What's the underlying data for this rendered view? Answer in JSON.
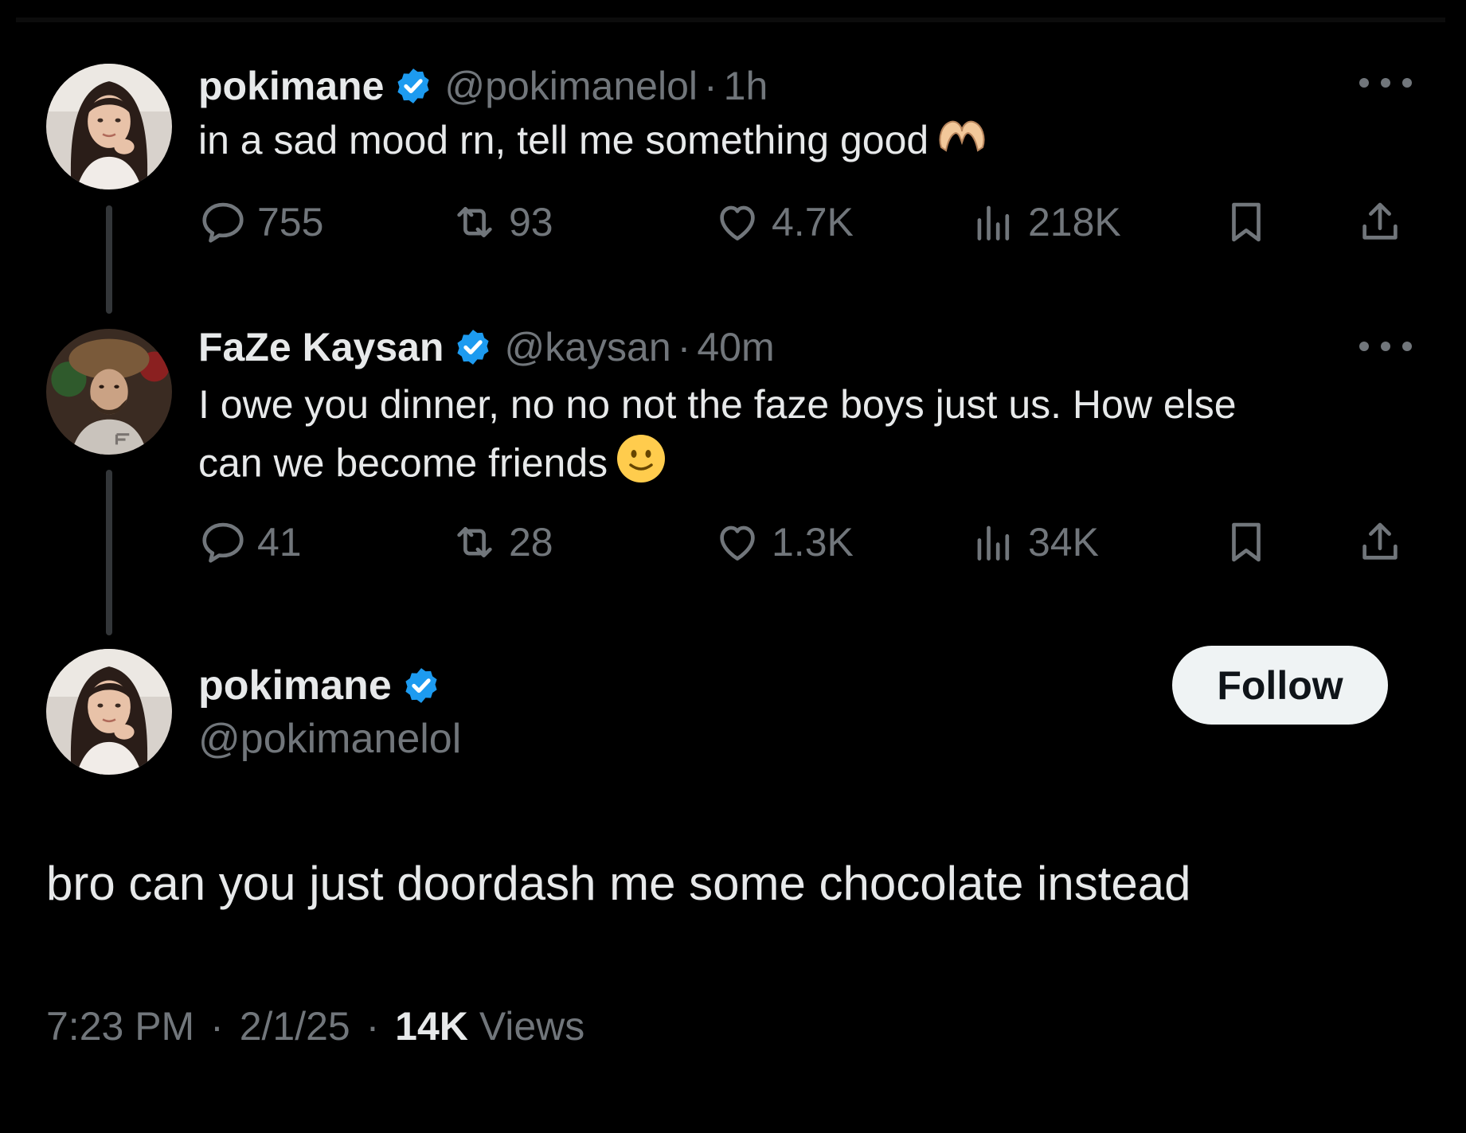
{
  "colors": {
    "background": "#000000",
    "primary_text": "#e7e9ea",
    "secondary_text": "#71767b",
    "verified_badge": "#1d9bf0",
    "follow_button_bg": "#eff3f4",
    "follow_button_text": "#0f1419"
  },
  "thread": [
    {
      "display_name": "pokimane",
      "verified": true,
      "handle": "@pokimanelol",
      "time": "1h",
      "text": "in a sad mood rn, tell me something good",
      "emoji": "heart-hands",
      "actions": {
        "replies": "755",
        "reposts": "93",
        "likes": "4.7K",
        "views": "218K"
      }
    },
    {
      "display_name": "FaZe Kaysan",
      "verified": true,
      "handle": "@kaysan",
      "time": "40m",
      "text_line1": "I owe you dinner, no no not the faze boys just us. How else",
      "text_line2": "can we become friends",
      "emoji": "slightly-smiling-face",
      "actions": {
        "replies": "41",
        "reposts": "28",
        "likes": "1.3K",
        "views": "34K"
      }
    }
  ],
  "main_tweet": {
    "display_name": "pokimane",
    "verified": true,
    "handle": "@pokimanelol",
    "follow_label": "Follow",
    "text": "bro can you just doordash me some chocolate instead",
    "time": "7:23 PM",
    "date": "2/1/25",
    "views_count": "14K",
    "views_label": "Views",
    "separator": "·"
  }
}
